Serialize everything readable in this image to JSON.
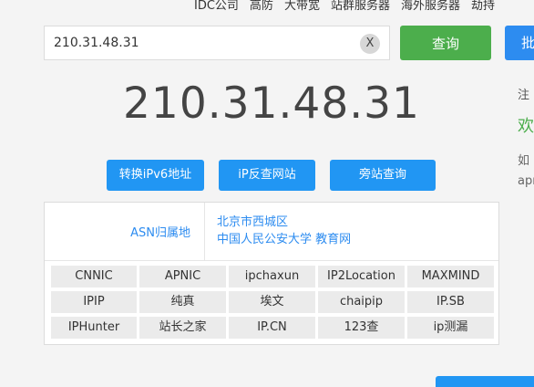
{
  "topnav": [
    "IDC公司",
    "高防",
    "大带宽",
    "站群服务器",
    "海外服务器",
    "劫持"
  ],
  "search": {
    "value": "210.31.48.31",
    "clear_label": "X",
    "query_label": "查询",
    "batch_label": "批"
  },
  "result": {
    "ip": "210.31.48.31"
  },
  "actions": {
    "ipv6": "转换iPv6地址",
    "reverse": "iP反查网站",
    "side": "旁站查询"
  },
  "asn": {
    "label": "ASN归属地",
    "line1": "北京市西城区",
    "line2": "中国人民公安大学 教育网"
  },
  "sources": [
    "CNNIC",
    "APNIC",
    "ipchaxun",
    "IP2Location",
    "MAXMIND",
    "IPIP",
    "纯真",
    "埃文",
    "chaipip",
    "IP.SB",
    "IPHunter",
    "站长之家",
    "IP.CN",
    "123查",
    "ip测漏"
  ],
  "side": {
    "note": "注",
    "welcome": "欢",
    "line1": "如",
    "line2": "apr"
  },
  "colors": {
    "green": "#4cae4c",
    "blue": "#2196f3",
    "link": "#2d8cf0"
  }
}
